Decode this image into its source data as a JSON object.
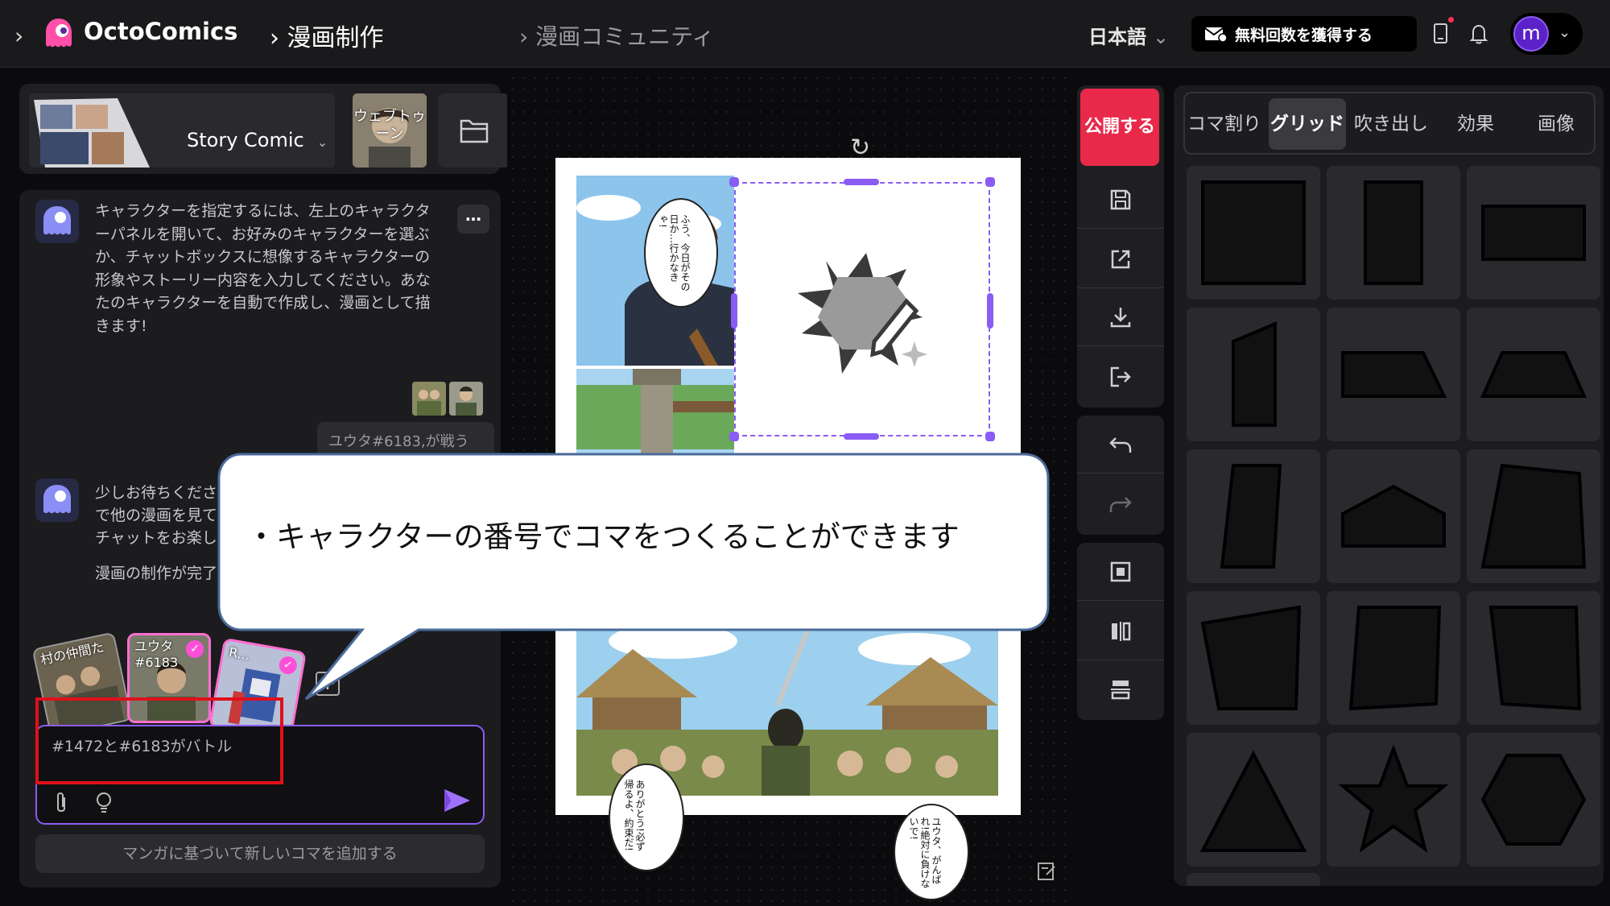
{
  "header": {
    "brand": "OctoComics",
    "nav_current": "漫画制作",
    "nav_community": "漫画コミュニティ",
    "language": "日本語",
    "get_free_label": "無料回数を獲得する",
    "avatar_initial": "m",
    "accent_color": "#8a5cf5",
    "brand_color": "#ff4fa8"
  },
  "style_bar": {
    "style_name": "Story Comic",
    "webtoon_label": "ウェブトゥーン"
  },
  "chat": {
    "bot_message_1": "キャラクターを指定するには、左上のキャラクターパネルを開いて、お好みのキャラクターを選ぶか、チャットボックスに想像するキャラクターの形象やストーリー内容を入力してください。あなたのキャラクターを自動で作成し、漫画として描きます!",
    "user_message": "ユウタ#6183,が戦う",
    "bot_message_2a": "少しお待ちくださ",
    "bot_message_2b": "で他の漫画を見て",
    "bot_message_2c": "チャットをお楽し",
    "bot_message_3": "漫画の制作が完了",
    "more_label": "…",
    "characters": [
      {
        "label": "村の仲間た",
        "selected": false
      },
      {
        "label": "ユウタ#6183",
        "selected": true
      },
      {
        "label": "R...",
        "selected": true
      }
    ],
    "input_value": "#1472と#6183がバトル",
    "add_panel_button": "マンガに基づいて新しいコマを追加する"
  },
  "canvas": {
    "bubble_1": "ふう、今日がその日か…行かなきゃ!",
    "bubble_2": "ありがとう!必ず帰るよ、約束だ!",
    "bubble_3": "ユウタ、がんばれ!絶対に負けないで!"
  },
  "callout": {
    "text": "・キャラクターの番号でコマをつくることができます"
  },
  "tools": {
    "publish_label": "公開する"
  },
  "right_panel": {
    "tabs": [
      "コマ割り",
      "グリッド",
      "吹き出し",
      "効果",
      "画像"
    ],
    "active_tab": "グリッド",
    "shapes": [
      "square",
      "tall-rectangle",
      "wide-rectangle",
      "slanted-parallelogram",
      "trapezoid-right",
      "trapezoid",
      "slanted-tall",
      "pentagon-house",
      "skewed-quad",
      "skewed-quad-2",
      "skewed-quad-3",
      "skewed-quad-4",
      "triangle",
      "star",
      "hexagon"
    ]
  }
}
